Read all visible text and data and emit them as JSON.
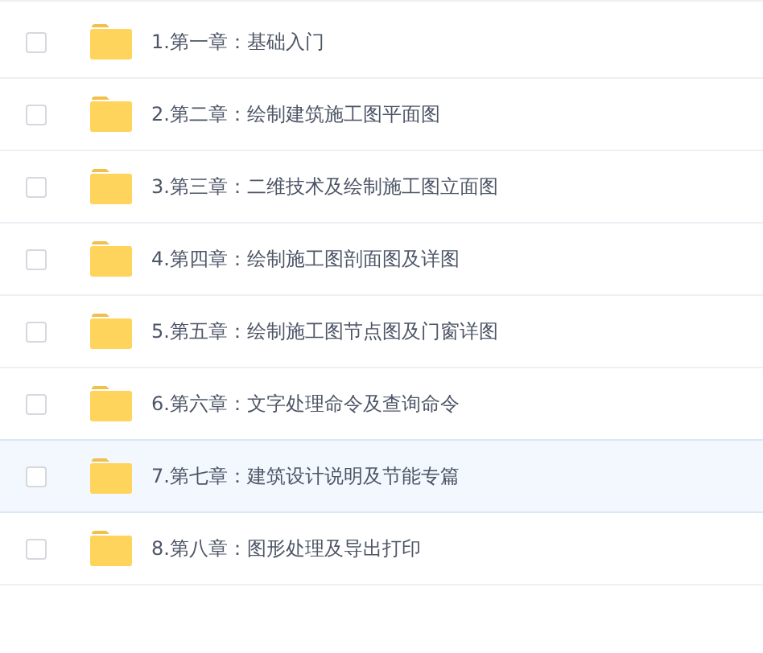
{
  "files": [
    {
      "name": "1.第一章：基础入门",
      "checked": false,
      "selected": false
    },
    {
      "name": "2.第二章：绘制建筑施工图平面图",
      "checked": false,
      "selected": false
    },
    {
      "name": "3.第三章：二维技术及绘制施工图立面图",
      "checked": false,
      "selected": false
    },
    {
      "name": "4.第四章：绘制施工图剖面图及详图",
      "checked": false,
      "selected": false
    },
    {
      "name": "5.第五章：绘制施工图节点图及门窗详图",
      "checked": false,
      "selected": false
    },
    {
      "name": "6.第六章：文字处理命令及查询命令",
      "checked": false,
      "selected": false
    },
    {
      "name": "7.第七章：建筑设计说明及节能专篇",
      "checked": false,
      "selected": true
    },
    {
      "name": "8.第八章：图形处理及导出打印",
      "checked": false,
      "selected": false
    }
  ]
}
